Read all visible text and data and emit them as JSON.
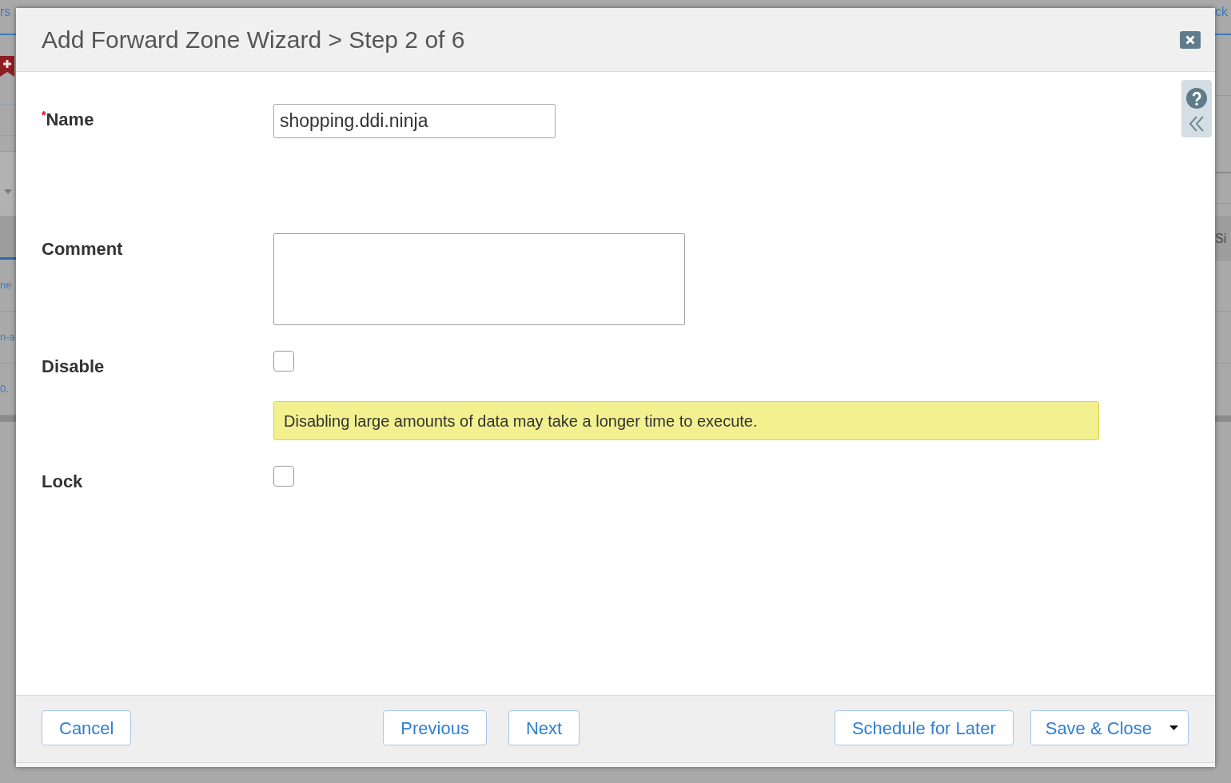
{
  "backdrop": {
    "top_left_tab": "rs",
    "top_right_tab": "ck",
    "left_column": [
      "ne",
      "n-a",
      "0."
    ],
    "right_cell": "Si"
  },
  "dialog": {
    "title": "Add Forward Zone Wizard > Step 2 of 6",
    "fields": [
      {
        "kind": "text",
        "label": "Name",
        "required_mark": "*",
        "value": "shopping.ddi.ninja"
      },
      {
        "kind": "textarea",
        "label": "Comment"
      },
      {
        "kind": "checkbox",
        "label": "Disable",
        "checked": false,
        "note": "Disabling large amounts of data may take a longer time to execute."
      },
      {
        "kind": "checkbox",
        "label": "Lock",
        "checked": false
      }
    ],
    "footer": {
      "left": [
        {
          "label": "Cancel",
          "kind": "plain"
        }
      ],
      "center": [
        {
          "label": "Previous",
          "kind": "plain"
        },
        {
          "label": "Next",
          "kind": "plain"
        }
      ],
      "right": [
        {
          "label": "Schedule for Later",
          "kind": "plain"
        },
        {
          "label": "Save & Close",
          "kind": "split"
        }
      ]
    }
  }
}
